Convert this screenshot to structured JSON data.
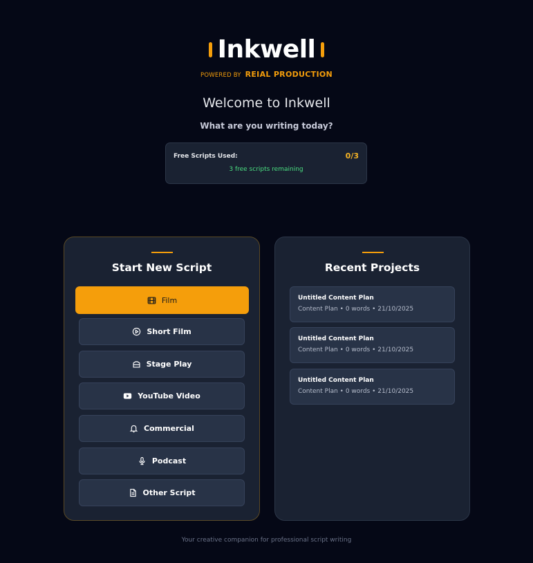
{
  "brand": {
    "name": "Inkwell",
    "powered_by": "POWERED BY",
    "company": "REIAL PRODUCTION"
  },
  "header": {
    "welcome": "Welcome to Inkwell",
    "subtitle": "What are you writing today?"
  },
  "usage": {
    "label": "Free Scripts Used:",
    "count": "0/3",
    "remaining": "3 free scripts remaining"
  },
  "new_script": {
    "title": "Start New Script",
    "types": [
      {
        "label": "Film",
        "icon": "film-icon",
        "active": true
      },
      {
        "label": "Short Film",
        "icon": "play-circle-icon",
        "active": false
      },
      {
        "label": "Stage Play",
        "icon": "theater-icon",
        "active": false
      },
      {
        "label": "YouTube Video",
        "icon": "youtube-icon",
        "active": false
      },
      {
        "label": "Commercial",
        "icon": "bell-icon",
        "active": false
      },
      {
        "label": "Podcast",
        "icon": "microphone-icon",
        "active": false
      },
      {
        "label": "Other Script",
        "icon": "document-icon",
        "active": false
      }
    ]
  },
  "recent": {
    "title": "Recent Projects",
    "projects": [
      {
        "title": "Untitled Content Plan",
        "meta": "Content Plan • 0 words • 21/10/2025"
      },
      {
        "title": "Untitled Content Plan",
        "meta": "Content Plan • 0 words • 21/10/2025"
      },
      {
        "title": "Untitled Content Plan",
        "meta": "Content Plan • 0 words • 21/10/2025"
      }
    ]
  },
  "footer": {
    "tagline": "Your creative companion for professional script writing"
  },
  "colors": {
    "background": "#050816",
    "panel": "#1a2232",
    "accent": "#f59e0b",
    "success": "#4ade80",
    "button": "#283347"
  }
}
